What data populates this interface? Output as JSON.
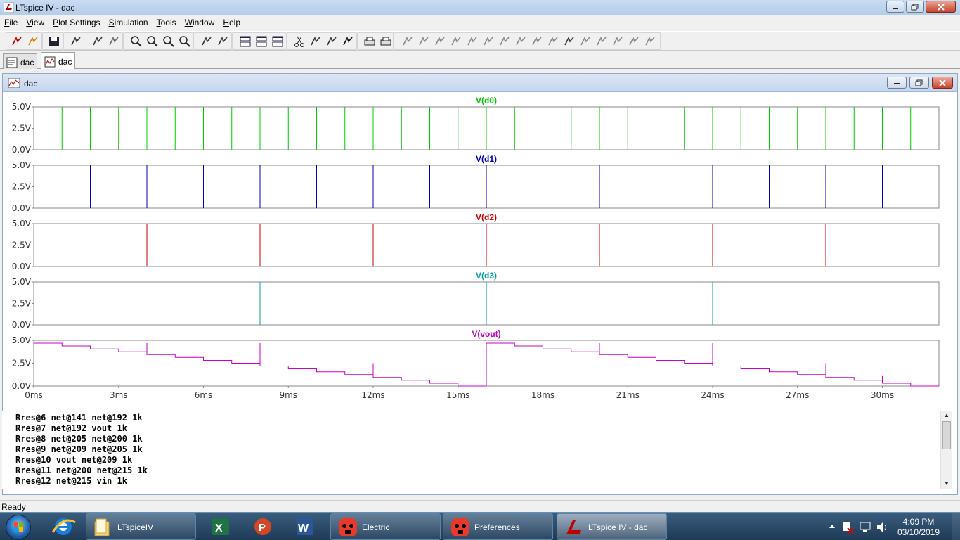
{
  "window": {
    "title": "LTspice IV - dac"
  },
  "menu": [
    {
      "label": "File",
      "key": "F"
    },
    {
      "label": "View",
      "key": "V"
    },
    {
      "label": "Plot Settings",
      "key": "P"
    },
    {
      "label": "Simulation",
      "key": "S"
    },
    {
      "label": "Tools",
      "key": "T"
    },
    {
      "label": "Window",
      "key": "W"
    },
    {
      "label": "Help",
      "key": "H"
    }
  ],
  "toolbar": {
    "buttons": [
      "new-schematic-icon",
      "open-icon",
      "save-icon",
      "control-panel-icon",
      "run-icon",
      "halt-icon",
      "zoom-in-icon",
      "zoom-out-icon",
      "zoom-back-icon",
      "zoom-cancel-icon",
      "autorange-icon",
      "mark-unconnected-icon",
      "tile-horizontal-icon",
      "cascade-icon",
      "close-all-icon",
      "cut-icon",
      "copy-icon",
      "paste-icon",
      "find-icon",
      "print-setup-icon",
      "print-icon",
      "wire-icon",
      "ground-icon",
      "label-net-icon",
      "resistor-icon",
      "capacitor-icon",
      "inductor-icon",
      "diode-icon",
      "component-icon",
      "move-icon",
      "drag-icon",
      "undo-icon",
      "redo-icon",
      "rotate-icon",
      "mirror-icon",
      "text-icon",
      "spice-directive-icon"
    ]
  },
  "doc_tabs": [
    {
      "label": "dac",
      "kind": "schematic"
    },
    {
      "label": "dac",
      "kind": "waveform"
    }
  ],
  "plot_window": {
    "title": "dac"
  },
  "chart_data": {
    "type": "line",
    "xlabel": "",
    "x_ticks": [
      "0ms",
      "3ms",
      "6ms",
      "9ms",
      "12ms",
      "15ms",
      "18ms",
      "21ms",
      "24ms",
      "27ms",
      "30ms"
    ],
    "xlim_ms": [
      0,
      32
    ],
    "panes": [
      {
        "name": "V(d0)",
        "color": "#00c800",
        "yticks": [
          "5.0V",
          "2.5V",
          "0.0V"
        ],
        "ylim": [
          0,
          5
        ],
        "spike_times_ms": [
          1,
          2,
          3,
          4,
          5,
          6,
          7,
          8,
          9,
          10,
          11,
          12,
          13,
          14,
          15,
          16,
          17,
          18,
          19,
          20,
          21,
          22,
          23,
          24,
          25,
          26,
          27,
          28,
          29,
          30,
          31
        ],
        "spike_value": 5.0
      },
      {
        "name": "V(d1)",
        "color": "#0000b4",
        "yticks": [
          "5.0V",
          "2.5V",
          "0.0V"
        ],
        "ylim": [
          0,
          5
        ],
        "spike_times_ms": [
          2,
          4,
          6,
          8,
          10,
          12,
          14,
          16,
          18,
          20,
          22,
          24,
          26,
          28,
          30
        ],
        "spike_value": 5.0
      },
      {
        "name": "V(d2)",
        "color": "#c80000",
        "yticks": [
          "5.0V",
          "2.5V",
          "0.0V"
        ],
        "ylim": [
          0,
          5
        ],
        "spike_times_ms": [
          4,
          8,
          12,
          16,
          20,
          24,
          28
        ],
        "spike_value": 5.0
      },
      {
        "name": "V(d3)",
        "color": "#00a0a0",
        "yticks": [
          "5.0V",
          "2.5V",
          "0.0V"
        ],
        "ylim": [
          0,
          5
        ],
        "spike_times_ms": [
          8,
          16,
          24
        ],
        "spike_value": 5.0
      },
      {
        "name": "V(vout)",
        "color": "#c800c8",
        "yticks": [
          "5.0V",
          "2.5V",
          "0.0V"
        ],
        "ylim": [
          0,
          5
        ],
        "steps": [
          [
            0,
            4.69
          ],
          [
            1,
            4.38
          ],
          [
            2,
            4.06
          ],
          [
            3,
            3.75
          ],
          [
            4,
            3.44
          ],
          [
            5,
            3.13
          ],
          [
            6,
            2.81
          ],
          [
            7,
            2.5
          ],
          [
            8,
            2.19
          ],
          [
            9,
            1.88
          ],
          [
            10,
            1.56
          ],
          [
            11,
            1.25
          ],
          [
            12,
            0.94
          ],
          [
            13,
            0.63
          ],
          [
            14,
            0.31
          ],
          [
            15,
            0.0
          ],
          [
            16,
            4.69
          ],
          [
            17,
            4.38
          ],
          [
            18,
            4.06
          ],
          [
            19,
            3.75
          ],
          [
            20,
            3.44
          ],
          [
            21,
            3.13
          ],
          [
            22,
            2.81
          ],
          [
            23,
            2.5
          ],
          [
            24,
            2.19
          ],
          [
            25,
            1.88
          ],
          [
            26,
            1.56
          ],
          [
            27,
            1.25
          ],
          [
            28,
            0.94
          ],
          [
            29,
            0.63
          ],
          [
            30,
            0.31
          ],
          [
            31,
            0.0
          ]
        ],
        "glitches": [
          [
            4,
            4.69
          ],
          [
            8,
            4.69
          ],
          [
            12,
            2.5
          ],
          [
            16,
            4.69
          ],
          [
            20,
            4.69
          ],
          [
            24,
            4.69
          ],
          [
            28,
            2.5
          ],
          [
            30,
            1.1
          ]
        ]
      }
    ]
  },
  "netlist": [
    "Rres@6 net@141 net@192 1k",
    "Rres@7 net@192 vout 1k",
    "Rres@8 net@205 net@200 1k",
    "Rres@9 net@209 net@205 1k",
    "Rres@10 vout net@209 1k",
    "Rres@11 net@200 net@215 1k",
    "Rres@12 net@215 vin 1k"
  ],
  "status": {
    "text": "Ready"
  },
  "taskbar": {
    "tasks": [
      {
        "label": "LTspiceIV",
        "icon": "folder-icon"
      },
      {
        "label": "Electric",
        "icon": "electric-icon"
      },
      {
        "label": "Preferences",
        "icon": "electric-icon"
      },
      {
        "label": "LTspice IV - dac",
        "icon": "ltspice-icon",
        "active": true
      }
    ],
    "pinned": [
      "ie-icon",
      "excel-icon",
      "powerpoint-icon",
      "word-icon"
    ],
    "clock": {
      "time": "4:09 PM",
      "date": "03/10/2019"
    }
  }
}
